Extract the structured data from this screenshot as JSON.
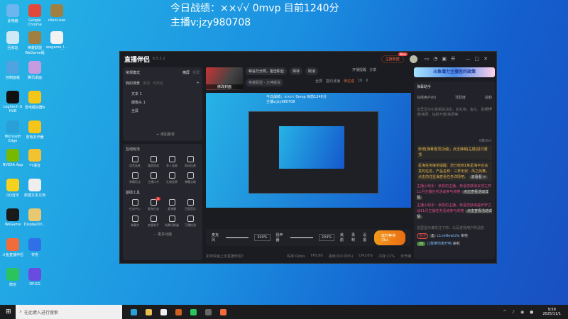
{
  "overlay": {
    "line1": "今日战绩：××√√ 0mvp  目前1240分",
    "line2": "主播v:jzy980708"
  },
  "desktop_icons": [
    {
      "label": "此电脑",
      "color": "#6cb6f0"
    },
    {
      "label": "Google Chrome",
      "color": "#e3493b"
    },
    {
      "label": "client.exe",
      "color": "#a08040"
    },
    {
      "label": "回收站",
      "color": "#cfe8f5"
    },
    {
      "label": "英雄联盟WeGame版",
      "color": "#a08040"
    },
    {
      "label": "wegame_l...",
      "color": "#f2f2f2"
    },
    {
      "label": "控制面板",
      "color": "#4fa3e0"
    },
    {
      "label": "腾讯桌面",
      "color": "#c79be0"
    },
    {
      "label": "Logitech G HUB",
      "color": "#111"
    },
    {
      "label": "雷电模拟器9",
      "color": "#f5c518"
    },
    {
      "label": "Microsoft Edge",
      "color": "#2aa0d8"
    },
    {
      "label": "雷电多开器",
      "color": "#f5c518"
    },
    {
      "label": "NVIDIA App",
      "color": "#76b900"
    },
    {
      "label": "YY语音",
      "color": "#f2c230"
    },
    {
      "label": "QQ音乐",
      "color": "#f7d21c"
    },
    {
      "label": "新建文本文档",
      "color": "#eee"
    },
    {
      "label": "WeGame",
      "color": "#1a1a1a"
    },
    {
      "label": "DisplayDri...",
      "color": "#e8c870"
    },
    {
      "label": "斗鱼直播伴侣",
      "color": "#f26b3a"
    },
    {
      "label": "夸克",
      "color": "#2f6fe8"
    },
    {
      "label": "微信",
      "color": "#2ac35e"
    },
    {
      "label": "OP.GG",
      "color": "#6a4be0"
    }
  ],
  "app": {
    "name": "直播伴侣",
    "version": "6.5.2.2",
    "data_btn": "主播数据",
    "new_badge": "New",
    "mode": "常规模式",
    "mode_tabs": [
      "横屏",
      "竖屏"
    ],
    "scenes_title": "我的场景",
    "scene_actions": [
      "添加",
      "可改名"
    ],
    "sources": [
      "文本 1",
      "摄像头 1",
      "全屏"
    ],
    "add_source": "+ 添加素材",
    "interact_title": "互动玩法",
    "interact": [
      "语音连麦",
      "幅度挑战",
      "多人连麦",
      "陪玩连麦",
      "弹幕玩法",
      "主播口令",
      "礼物投票",
      "弹幕点歌"
    ],
    "tools_title": "基础工具",
    "tools": [
      "任务中心",
      "星海任务",
      "瓷弹幕",
      "正版音乐",
      "弹幕秀",
      "房管助手",
      "场景切换器",
      "下播检测"
    ],
    "tools_badge": "2",
    "more": "··· 更多功能",
    "stream_title": "峡谷万分局，狙击职业",
    "save": "保存",
    "cancel": "取消",
    "cover": "修改封面",
    "category": "英雄联盟 - 大神解说",
    "notify": "开播提醒",
    "share": "分享",
    "fullscreen": "全屏",
    "monthly": "签约月播",
    "monthly_status": "未达成",
    "hot": "16",
    "likes": "0",
    "mic": "麦克风",
    "mic_vol": "300%",
    "speaker": "扬声器",
    "spk_vol": "204%",
    "beauty": "美颜",
    "record": "录制",
    "settings": "设置",
    "start": "延时等待(3s)",
    "help": "如何快速上手直播伴侣?",
    "status": [
      "码率:0kb/s",
      "FPS:60",
      "丢帧:0(0.00%)",
      "CPU:6%",
      "内存:21%",
      "未开播"
    ],
    "banner": "斗鱼潜力主播签约政策",
    "danmu_title": "弹幕助手",
    "danmu_tabs": [
      "在线用户(6)",
      "活跃度",
      "钻粉"
    ],
    "gift_hint": "这里显示礼物相关消息，如礼物、鱼丸、贵族开通/续费、钻粉开通/续费等",
    "gift_value": "0.0",
    "counter": "0条/0人",
    "msgs": [
      "新增[弹幕置顶]功能，点击弹幕[左键]进行置顶",
      "星海任务接单提醒：您已收到1条星海平台派发的任务，产品名称：三界无双：风之剑舞，点击前往星海查看任务详情吧。",
      "主播小助手：亲爱的主播，恭喜您获得云顶之弈11月主播任务活动参与资格",
      "主播小助手：亲爱的主播，恭喜您获得金铲铲之战11月主播任务活动参与资格"
    ],
    "msg_links": [
      "去看看 >",
      "点击查看活动详情",
      "点击查看活动详情"
    ],
    "follow_hint": "这里显示谁关注了你，以及进场用户的消息",
    "entries": [
      {
        "badge": "关注",
        "lvl": "8",
        "name": "L1veNewLife",
        "action": "来啦"
      },
      {
        "badge": "",
        "lvl": "20",
        "name": "让我带你离开吧",
        "action": "来啦"
      }
    ]
  },
  "taskbar": {
    "search": "在此键入进行搜索",
    "time": "9:59",
    "date": "2025/11/1"
  }
}
